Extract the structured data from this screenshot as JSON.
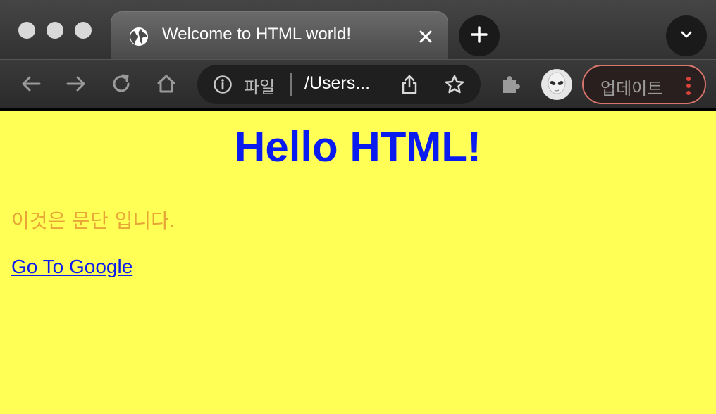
{
  "window": {
    "tab_title": "Welcome to HTML world!"
  },
  "omnibox": {
    "scheme_label": "파일",
    "url": "/Users..."
  },
  "toolbar": {
    "update_label": "업데이트"
  },
  "page": {
    "heading": "Hello HTML!",
    "paragraph": "이것은 문단 입니다.",
    "link_text": "Go To Google",
    "background_color": "#ffff55",
    "heading_color": "#0a1bf0",
    "paragraph_color": "#e8a637"
  },
  "icons": [
    "globe-icon",
    "close-icon",
    "plus-icon",
    "chevron-down-icon",
    "back-arrow-icon",
    "forward-arrow-icon",
    "reload-icon",
    "home-icon",
    "info-icon",
    "share-icon",
    "star-icon",
    "puzzle-icon",
    "avatar-alien-icon",
    "more-vertical-icon"
  ]
}
